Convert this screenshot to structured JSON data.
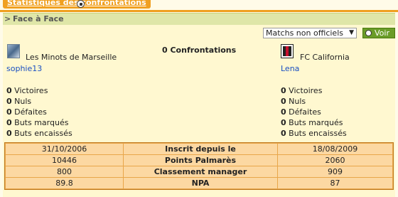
{
  "tab": {
    "label": "Statistiques des confrontations"
  },
  "section": {
    "arrow": ">",
    "title": "Face à Face"
  },
  "filter": {
    "selected": "Matchs non officiels",
    "button": "Voir"
  },
  "confrontations": "0 Confrontations",
  "left": {
    "team": "Les Minots de Marseille",
    "user": "sophie13",
    "stats": [
      {
        "value": "0",
        "label": "Victoires"
      },
      {
        "value": "0",
        "label": "Nuls"
      },
      {
        "value": "0",
        "label": "Défaites"
      },
      {
        "value": "0",
        "label": "Buts marqués"
      },
      {
        "value": "0",
        "label": "Buts encaissés"
      }
    ]
  },
  "right": {
    "team": "FC California",
    "user": "Lena",
    "stats": [
      {
        "value": "0",
        "label": "Victoires"
      },
      {
        "value": "0",
        "label": "Nuls"
      },
      {
        "value": "0",
        "label": "Défaites"
      },
      {
        "value": "0",
        "label": "Buts marqués"
      },
      {
        "value": "0",
        "label": "Buts encaissés"
      }
    ]
  },
  "comparison": [
    {
      "left": "31/10/2006",
      "label": "Inscrit depuis le",
      "right": "18/08/2009"
    },
    {
      "left": "10446",
      "label": "Points Palmarès",
      "right": "2060"
    },
    {
      "left": "800",
      "label": "Classement manager",
      "right": "909"
    },
    {
      "left": "89.8",
      "label": "NPA",
      "right": "87"
    }
  ],
  "colors": {
    "tab": "#f0a020",
    "section": "#dfe6a8",
    "link": "#1a4fc2",
    "button": "#6a9c28"
  }
}
